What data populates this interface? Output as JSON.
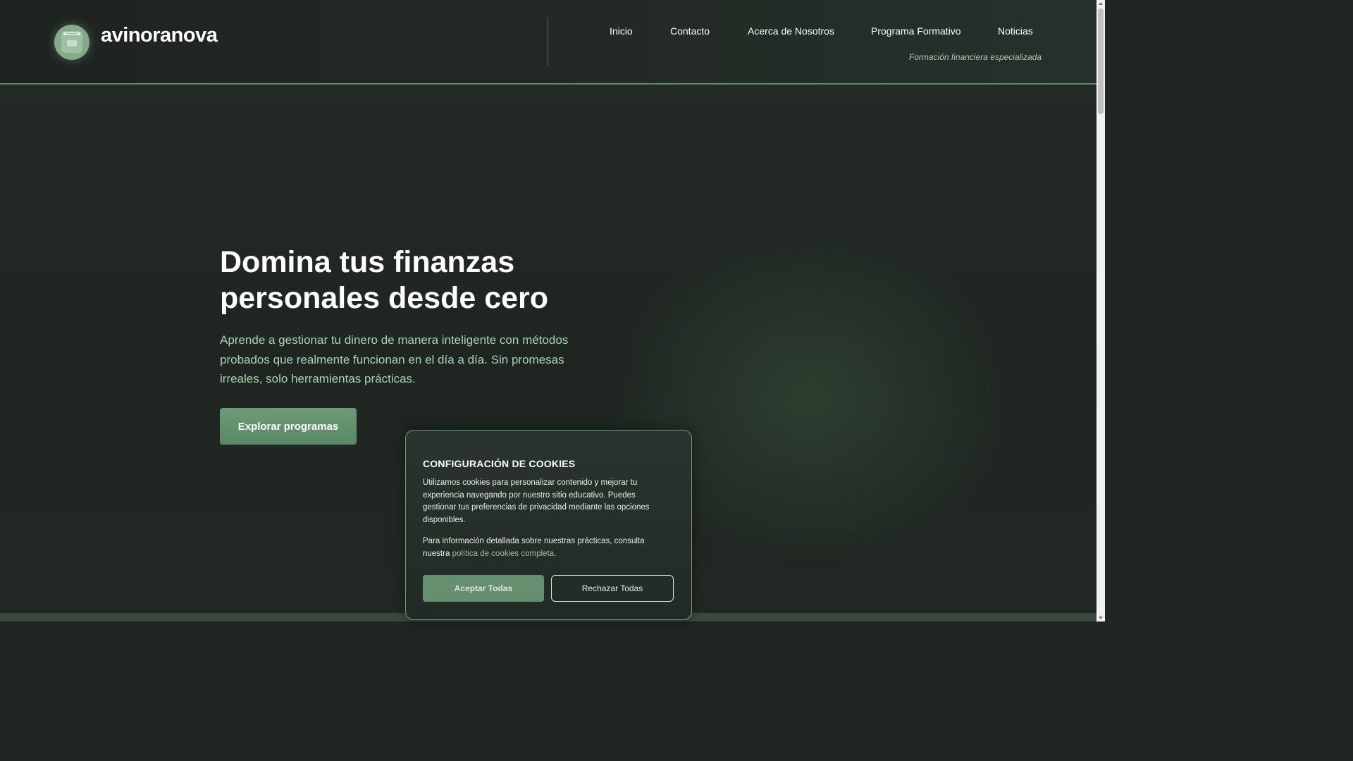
{
  "header": {
    "brand": "avinoranova",
    "tagline": "Formación financiera especializada",
    "nav": [
      "Inicio",
      "Contacto",
      "Acerca de Nosotros",
      "Programa Formativo",
      "Noticias"
    ]
  },
  "hero": {
    "title": "Domina tus finanzas personales desde cero",
    "text": "Aprende a gestionar tu dinero de manera inteligente con métodos probados que realmente funcionan en el día a día. Sin promesas irreales, solo herramientas prácticas.",
    "cta": "Explorar programas"
  },
  "cookie": {
    "title": "CONFIGURACIÓN DE COOKIES",
    "p1": "Utilizamos cookies para personalizar contenido y mejorar tu experiencia navegando por nuestro sitio educativo. Puedes gestionar tus preferencias de privacidad mediante las opciones disponibles.",
    "p2_before": "Para información detallada sobre nuestras prácticas, consulta nuestra ",
    "p2_link": "política de cookies completa",
    "p2_after": ".",
    "accept": "Aceptar Todas",
    "reject": "Rechazar Todas"
  },
  "colors": {
    "accent": "#5d8a66",
    "link": "#8ec39a",
    "hero_text": "#a9d2b3"
  },
  "icons": {
    "logo": "archive-box-icon"
  }
}
